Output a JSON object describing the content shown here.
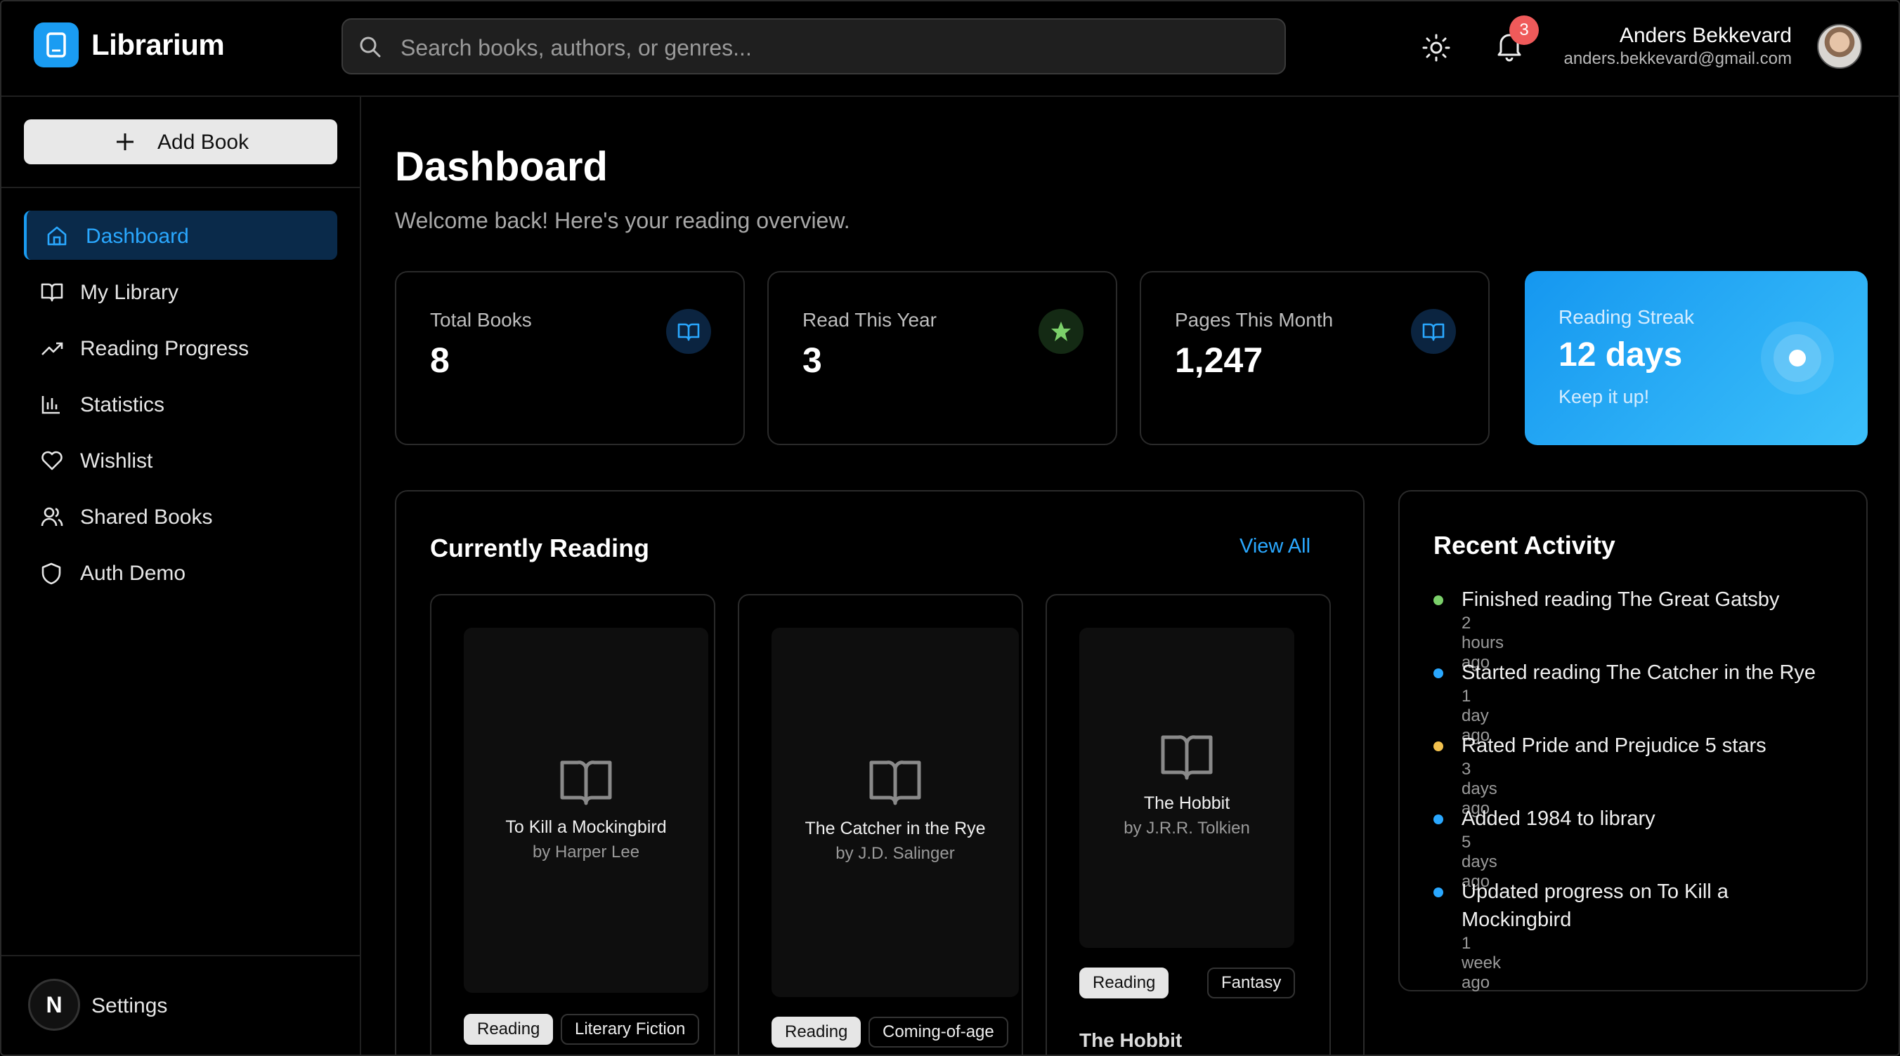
{
  "app": {
    "name": "Librarium"
  },
  "search": {
    "placeholder": "Search books, authors, or genres..."
  },
  "header": {
    "notification_count": "3",
    "user_name": "Anders Bekkevard",
    "user_email": "anders.bekkevard@gmail.com"
  },
  "sidebar": {
    "add_label": "Add Book",
    "items": [
      {
        "label": "Dashboard",
        "icon": "home-icon",
        "active": true
      },
      {
        "label": "My Library",
        "icon": "book-open-icon"
      },
      {
        "label": "Reading Progress",
        "icon": "trending-up-icon"
      },
      {
        "label": "Statistics",
        "icon": "bar-chart-icon"
      },
      {
        "label": "Wishlist",
        "icon": "heart-icon"
      },
      {
        "label": "Shared Books",
        "icon": "users-icon"
      },
      {
        "label": "Auth Demo",
        "icon": "shield-icon"
      }
    ],
    "settings_initial": "N",
    "settings_label": "Settings"
  },
  "page": {
    "title": "Dashboard",
    "subtitle": "Welcome back! Here's your reading overview."
  },
  "stats": [
    {
      "title": "Total Books",
      "value": "8",
      "icon": "book-open-icon"
    },
    {
      "title": "Read This Year",
      "value": "3",
      "icon": "star-icon"
    },
    {
      "title": "Pages This Month",
      "value": "1,247",
      "icon": "book-open-icon"
    }
  ],
  "streak": {
    "title": "Reading Streak",
    "value": "12 days",
    "note": "Keep it up!"
  },
  "currently_reading": {
    "title": "Currently Reading",
    "view_all": "View All",
    "books": [
      {
        "title": "To Kill a Mockingbird",
        "author": "by Harper Lee",
        "status": "Reading",
        "genre": "Literary Fiction"
      },
      {
        "title": "The Catcher in the Rye",
        "author": "by J.D. Salinger",
        "status": "Reading",
        "genre": "Coming-of-age"
      },
      {
        "title": "The Hobbit",
        "author": "by J.R.R. Tolkien",
        "status": "Reading",
        "genre": "Fantasy",
        "peek_title": "The Hobbit"
      }
    ]
  },
  "recent_activity": {
    "title": "Recent Activity",
    "items": [
      {
        "text": "Finished reading The Great Gatsby",
        "time": "2 hours ago",
        "color": "#7bd06a"
      },
      {
        "text": "Started reading The Catcher in the Rye",
        "time": "1 day ago",
        "color": "#2aa8ff"
      },
      {
        "text": "Rated Pride and Prejudice 5 stars",
        "time": "3 days ago",
        "color": "#f2c14e"
      },
      {
        "text": "Added 1984 to library",
        "time": "5 days ago",
        "color": "#2aa8ff"
      },
      {
        "text": "Updated progress on To Kill a Mockingbird",
        "time": "1 week ago",
        "color": "#2aa8ff"
      }
    ]
  },
  "colors": {
    "accent": "#1a9cf2",
    "active_bg": "#0a2a4a",
    "badge": "#ef5a5a"
  }
}
